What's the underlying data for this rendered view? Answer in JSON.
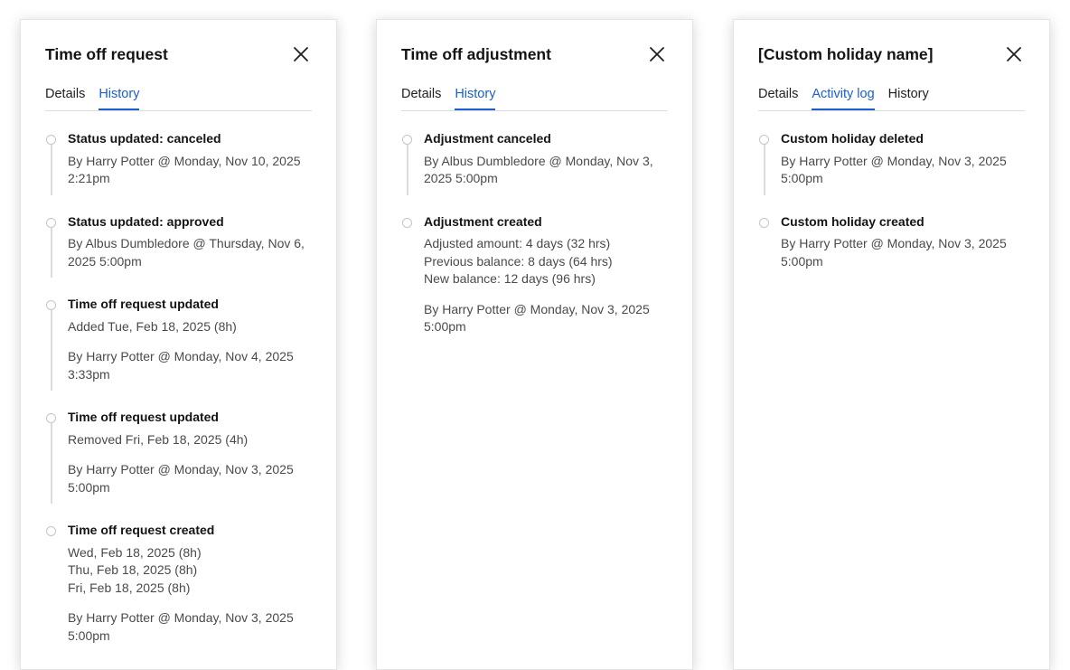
{
  "panels": [
    {
      "title": "Time off request",
      "tabs": [
        {
          "label": "Details",
          "active": false
        },
        {
          "label": "History",
          "active": true
        }
      ],
      "entries": [
        {
          "title": "Status updated: canceled",
          "details": [],
          "byline": "By Harry Potter @ Monday, Nov 10, 2025 2:21pm"
        },
        {
          "title": "Status updated: approved",
          "details": [],
          "byline": "By Albus Dumbledore @ Thursday, Nov 6, 2025 5:00pm"
        },
        {
          "title": "Time off request updated",
          "details": [
            "Added Tue, Feb 18, 2025 (8h)"
          ],
          "byline": "By Harry Potter @ Monday, Nov 4, 2025 3:33pm"
        },
        {
          "title": "Time off request updated",
          "details": [
            "Removed Fri, Feb 18, 2025 (4h)"
          ],
          "byline": "By Harry Potter @ Monday, Nov 3, 2025 5:00pm"
        },
        {
          "title": "Time off request created",
          "details": [
            "Wed, Feb 18, 2025 (8h)",
            "Thu, Feb 18, 2025 (8h)",
            "Fri, Feb 18, 2025 (8h)"
          ],
          "byline": "By Harry Potter @ Monday, Nov 3, 2025 5:00pm"
        }
      ]
    },
    {
      "title": "Time off adjustment",
      "tabs": [
        {
          "label": "Details",
          "active": false
        },
        {
          "label": "History",
          "active": true
        }
      ],
      "entries": [
        {
          "title": "Adjustment canceled",
          "details": [],
          "byline": "By Albus Dumbledore @ Monday, Nov 3, 2025 5:00pm"
        },
        {
          "title": "Adjustment created",
          "details": [
            "Adjusted amount: 4 days (32 hrs)",
            "Previous balance: 8 days (64 hrs)",
            "New balance: 12 days (96 hrs)"
          ],
          "byline": "By Harry Potter @ Monday, Nov 3, 2025 5:00pm"
        }
      ]
    },
    {
      "title": "[Custom holiday name]",
      "tabs": [
        {
          "label": "Details",
          "active": false
        },
        {
          "label": "Activity log",
          "active": true
        },
        {
          "label": "History",
          "active": false
        }
      ],
      "entries": [
        {
          "title": "Custom holiday deleted",
          "details": [],
          "byline": "By Harry Potter @ Monday, Nov 3, 2025 5:00pm"
        },
        {
          "title": "Custom holiday created",
          "details": [],
          "byline": "By Harry Potter @ Monday, Nov 3, 2025 5:00pm"
        }
      ]
    }
  ],
  "icons": {
    "close": "close-icon",
    "timeline_dot": "timeline-dot-icon"
  },
  "colors": {
    "accent": "#1b5fc9",
    "title_text": "#141414",
    "body_text": "#4a4a4a",
    "divider": "#dddddd"
  }
}
